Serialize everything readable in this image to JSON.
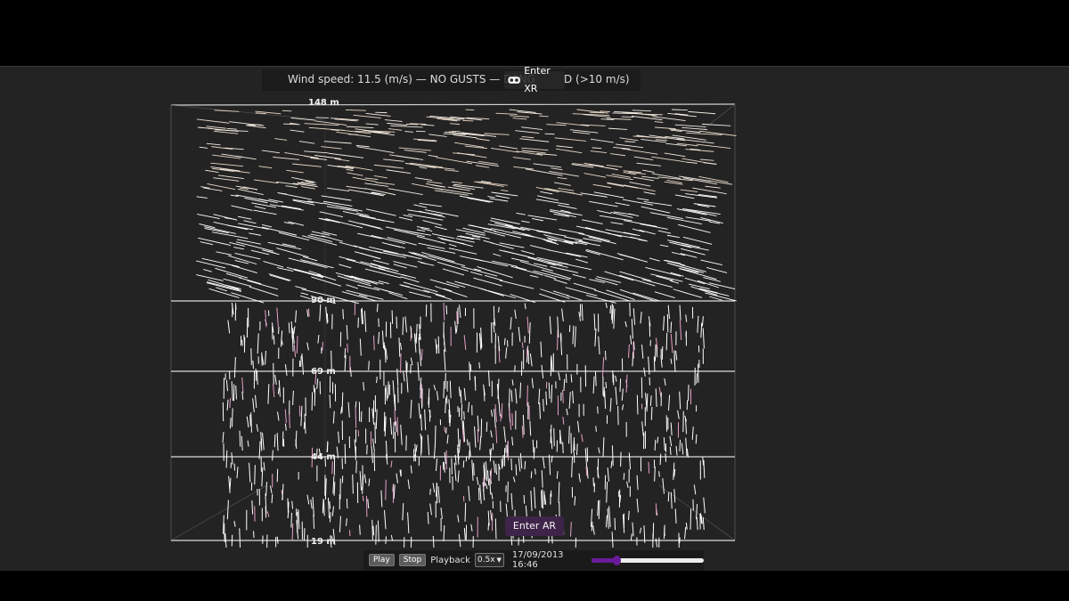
{
  "banner": {
    "status_text": "Wind speed: 11.5 (m/s) — NO GUSTS — DANG",
    "tail_text": "D (>10 m/s)"
  },
  "xr_button": {
    "label": "Enter XR",
    "icon": "vr-goggles-icon"
  },
  "ar_button": {
    "label": "Enter AR"
  },
  "levels": [
    "148 m",
    "90 m",
    "69 m",
    "44 m",
    "19 m"
  ],
  "controls": {
    "play_label": "Play",
    "stop_label": "Stop",
    "playback_label": "Playback",
    "speed_value": "0.5x",
    "datetime": "17/09/2013 16:46",
    "progress": 0.22
  },
  "colors": {
    "accent": "#6a1b9a",
    "ar_button": "#3f2449",
    "particle_top": "#e8d8c8",
    "particle": "#ffffff",
    "particle_pink": "#e8a0c8"
  }
}
